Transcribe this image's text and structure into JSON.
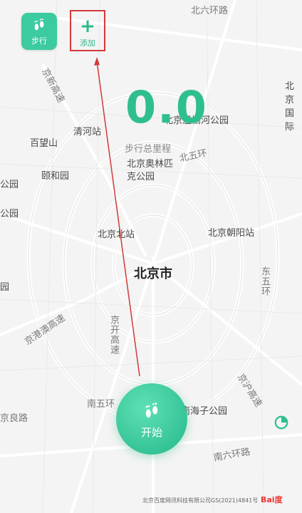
{
  "toolbar": {
    "walk_label": "步行",
    "add_label": "添加",
    "add_symbol": "+"
  },
  "stats": {
    "distance": "0.0",
    "distance_label": "步行总里程"
  },
  "start": {
    "label": "开始"
  },
  "map": {
    "labels": {
      "north_6th_ring": "北六环路",
      "jingxin": "京新高速",
      "beijing_guoji": "北京国际",
      "wenyuhe": "北京温榆河公园",
      "qinghe": "清河站",
      "baiwangshan": "百望山",
      "north_5th_ring": "北五环",
      "olympic": "北京奥林匹克公园",
      "yiheyuan": "颐和园",
      "park_left1": "公园",
      "park_left2": "公园",
      "beijing_north": "北京北站",
      "chaoyang": "北京朝阳站",
      "beijing_city": "北京市",
      "east_5th_ring": "东五环",
      "yuan_left": "园",
      "gangao": "京港澳高速",
      "jingkai": "京开高速",
      "jinghu": "京沪高速",
      "south_5th_ring": "南五环",
      "nanhaizi": "南海子公园",
      "liangxiang": "京良路",
      "south_6th_ring": "南六环路"
    },
    "copyright": "北京百度网讯科技有限公司GS(2021)4841号",
    "logo": "Bai度"
  },
  "colors": {
    "accent": "#2fbf8f",
    "annotation": "#d23a3a"
  }
}
